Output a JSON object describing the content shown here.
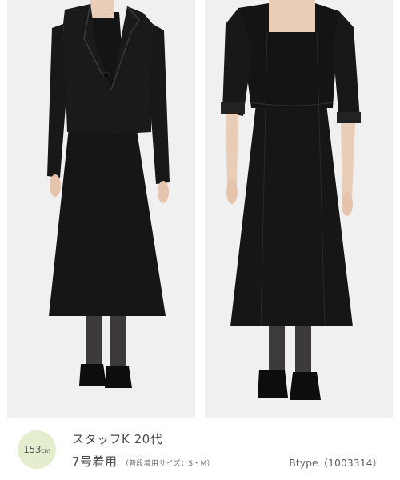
{
  "model_info": {
    "height_value": "153",
    "height_unit": "cm",
    "staff_name": "スタッフK 20代",
    "size_worn": "7号着用",
    "usual_size": "（普段着用サイズ：S・M）"
  },
  "product": {
    "type_code": "Btype（1003314）"
  },
  "photos": [
    {
      "name": "model-wearing-jacket-and-dress"
    },
    {
      "name": "model-wearing-dress-only"
    }
  ],
  "colors": {
    "background": "#ffffff",
    "photo_background": "#f0f0f0",
    "badge_background": "#e4edce",
    "garment": "#141414"
  }
}
